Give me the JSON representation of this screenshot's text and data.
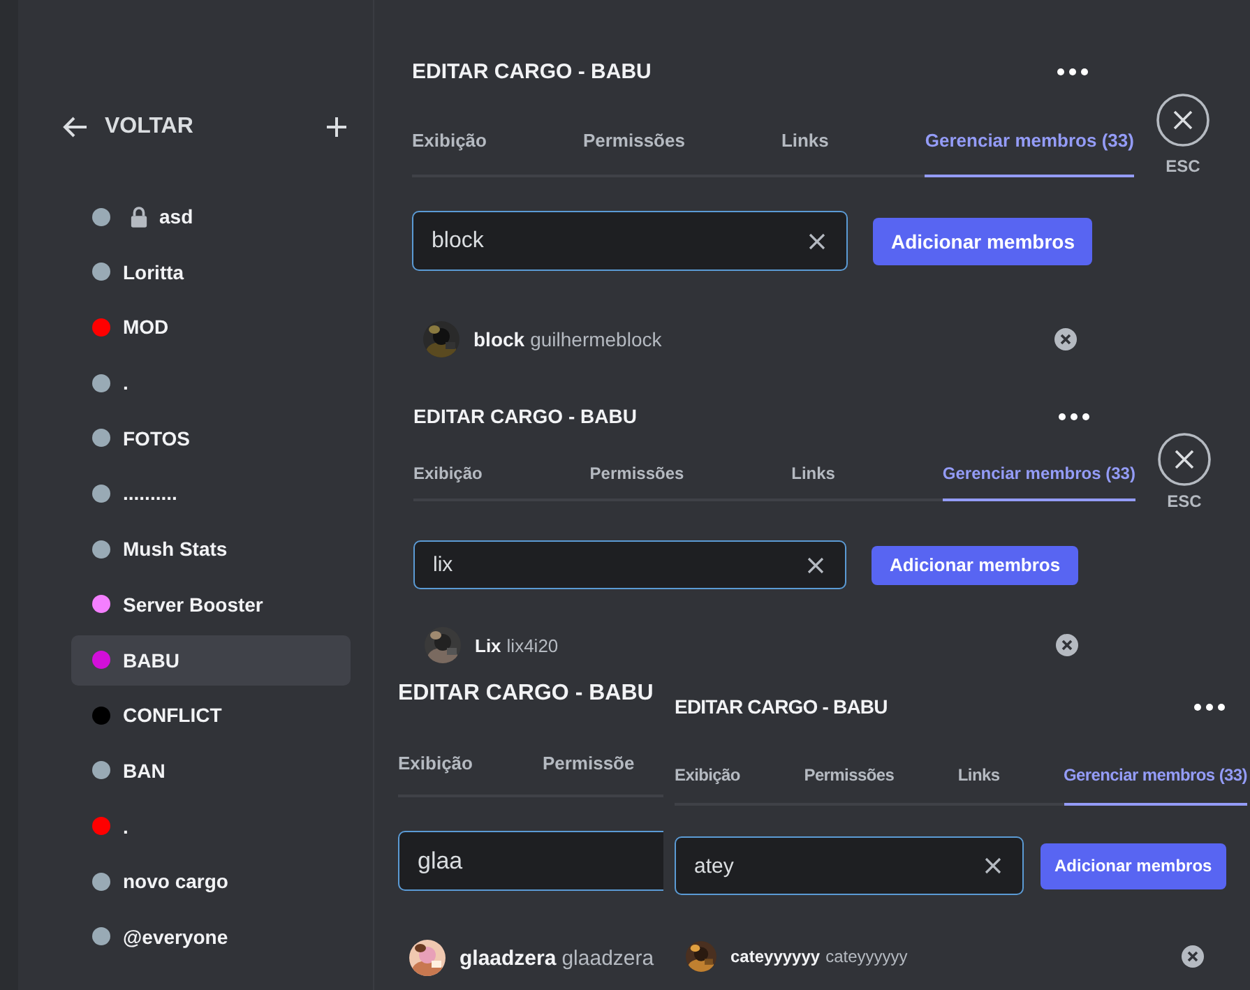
{
  "sidebar": {
    "back_label": "VOLTAR",
    "roles": [
      {
        "name": "asd",
        "color": "#99aab5",
        "locked": true,
        "selected": false
      },
      {
        "name": "Loritta",
        "color": "#99aab5",
        "locked": false,
        "selected": false
      },
      {
        "name": "MOD",
        "color": "#ff0000",
        "locked": false,
        "selected": false
      },
      {
        "name": ".",
        "color": "#99aab5",
        "locked": false,
        "selected": false
      },
      {
        "name": "FOTOS",
        "color": "#99aab5",
        "locked": false,
        "selected": false
      },
      {
        "name": "..........",
        "color": "#99aab5",
        "locked": false,
        "selected": false
      },
      {
        "name": "Mush Stats",
        "color": "#99aab5",
        "locked": false,
        "selected": false
      },
      {
        "name": "Server Booster",
        "color": "#f47fff",
        "locked": false,
        "selected": false
      },
      {
        "name": "BABU",
        "color": "#d20fd9",
        "locked": false,
        "selected": true
      },
      {
        "name": "CONFLICT",
        "color": "#000000",
        "locked": false,
        "selected": false
      },
      {
        "name": "BAN",
        "color": "#99aab5",
        "locked": false,
        "selected": false
      },
      {
        "name": ".",
        "color": "#ff0000",
        "locked": false,
        "selected": false
      },
      {
        "name": "novo cargo",
        "color": "#99aab5",
        "locked": false,
        "selected": false
      },
      {
        "name": "@everyone",
        "color": "#99aab5",
        "locked": false,
        "selected": false
      }
    ]
  },
  "panels": [
    {
      "title": "EDITAR CARGO - BABU",
      "more_menu": true,
      "tabs": [
        {
          "label": "Exibição",
          "selected": false
        },
        {
          "label": "Permissões",
          "selected": false
        },
        {
          "label": "Links",
          "selected": false
        },
        {
          "label": "Gerenciar membros (33)",
          "selected": true
        }
      ],
      "close_label": "ESC",
      "search": {
        "value": "block",
        "clearable": true
      },
      "add_button": "Adicionar membros",
      "members": [
        {
          "display_name": "block",
          "username": "guilhermeblock",
          "removable": true
        }
      ]
    },
    {
      "title": "EDITAR CARGO - BABU",
      "more_menu": true,
      "tabs": [
        {
          "label": "Exibição",
          "selected": false
        },
        {
          "label": "Permissões",
          "selected": false
        },
        {
          "label": "Links",
          "selected": false
        },
        {
          "label": "Gerenciar membros (33)",
          "selected": true
        }
      ],
      "close_label": "ESC",
      "search": {
        "value": "lix",
        "clearable": true
      },
      "add_button": "Adicionar membros",
      "members": [
        {
          "display_name": "Lix",
          "username": "lix4i20",
          "removable": true
        }
      ]
    },
    {
      "title": "EDITAR CARGO - BABU",
      "more_menu": false,
      "tabs": [
        {
          "label": "Exibição",
          "selected": false
        },
        {
          "label": "Permissõe",
          "selected": false
        }
      ],
      "search": {
        "value": "glaa"
      },
      "members": [
        {
          "display_name": "glaadzera",
          "username": "glaadzera",
          "removable": false
        }
      ]
    },
    {
      "title": "EDITAR CARGO - BABU",
      "more_menu": true,
      "tabs": [
        {
          "label": "Exibição",
          "selected": false
        },
        {
          "label": "Permissões",
          "selected": false
        },
        {
          "label": "Links",
          "selected": false
        },
        {
          "label": "Gerenciar membros (33)",
          "selected": true
        }
      ],
      "search": {
        "value": "atey",
        "clearable": true
      },
      "add_button": "Adicionar membros",
      "members": [
        {
          "display_name": "cateyyyyyy",
          "username": "cateyyyyyy",
          "removable": true
        }
      ]
    }
  ]
}
